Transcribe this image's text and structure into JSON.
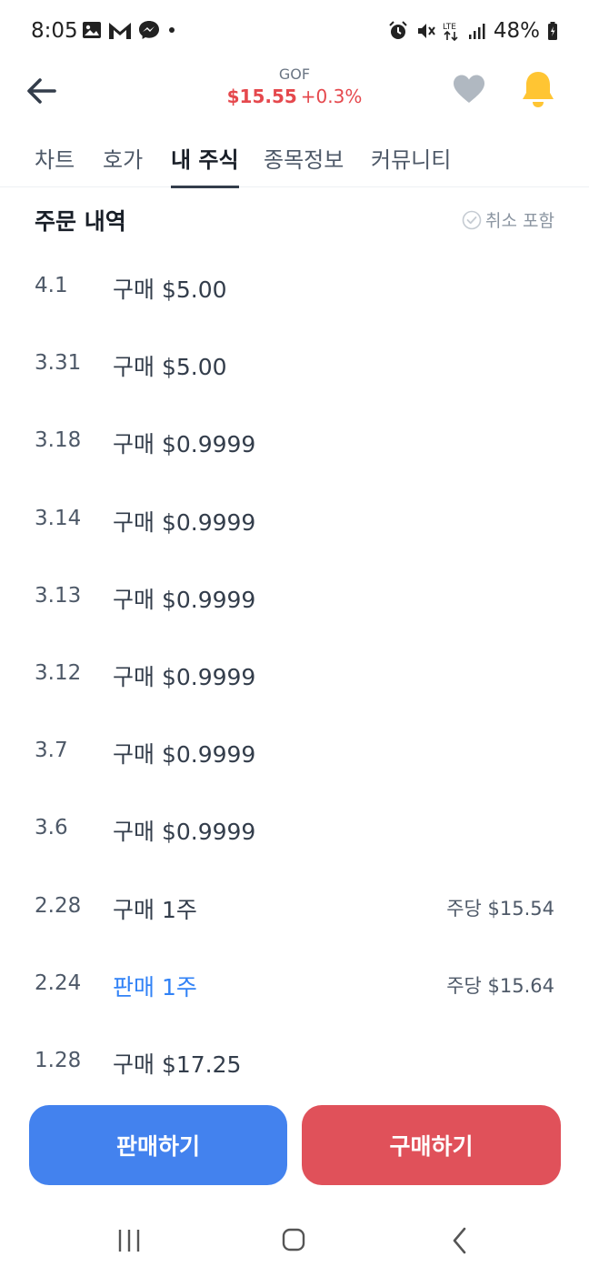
{
  "status_bar": {
    "time": "8:05",
    "battery": "48%",
    "left_icons": [
      "image-icon",
      "gmail-icon",
      "messenger-icon",
      "dot-icon"
    ],
    "right_icons": [
      "alarm-icon",
      "mute-icon",
      "lte-icon",
      "signal-icon",
      "battery-icon"
    ]
  },
  "header": {
    "ticker": "GOF",
    "price": "$15.55",
    "change": "+0.3%",
    "price_color": "#e5484d"
  },
  "tabs": [
    {
      "label": "차트",
      "active": false
    },
    {
      "label": "호가",
      "active": false
    },
    {
      "label": "내 주식",
      "active": true
    },
    {
      "label": "종목정보",
      "active": false
    },
    {
      "label": "커뮤니티",
      "active": false
    }
  ],
  "section": {
    "title": "주문 내역",
    "cancel_toggle_label": "취소 포함"
  },
  "orders": [
    {
      "date": "4.1",
      "desc": "구매 $5.00",
      "per": "",
      "type": "buy"
    },
    {
      "date": "3.31",
      "desc": "구매 $5.00",
      "per": "",
      "type": "buy"
    },
    {
      "date": "3.18",
      "desc": "구매 $0.9999",
      "per": "",
      "type": "buy"
    },
    {
      "date": "3.14",
      "desc": "구매 $0.9999",
      "per": "",
      "type": "buy"
    },
    {
      "date": "3.13",
      "desc": "구매 $0.9999",
      "per": "",
      "type": "buy"
    },
    {
      "date": "3.12",
      "desc": "구매 $0.9999",
      "per": "",
      "type": "buy"
    },
    {
      "date": "3.7",
      "desc": "구매 $0.9999",
      "per": "",
      "type": "buy"
    },
    {
      "date": "3.6",
      "desc": "구매 $0.9999",
      "per": "",
      "type": "buy"
    },
    {
      "date": "2.28",
      "desc": "구매 1주",
      "per": "주당 $15.54",
      "type": "buy"
    },
    {
      "date": "2.24",
      "desc": "판매 1주",
      "per": "주당 $15.64",
      "type": "sell"
    },
    {
      "date": "1.28",
      "desc": "구매 $17.25",
      "per": "",
      "type": "buy"
    }
  ],
  "actions": {
    "sell_label": "판매하기",
    "buy_label": "구매하기",
    "sell_color": "#4382ee",
    "buy_color": "#e0515a"
  },
  "nav": [
    "recent-apps-icon",
    "home-icon",
    "back-nav-icon"
  ]
}
